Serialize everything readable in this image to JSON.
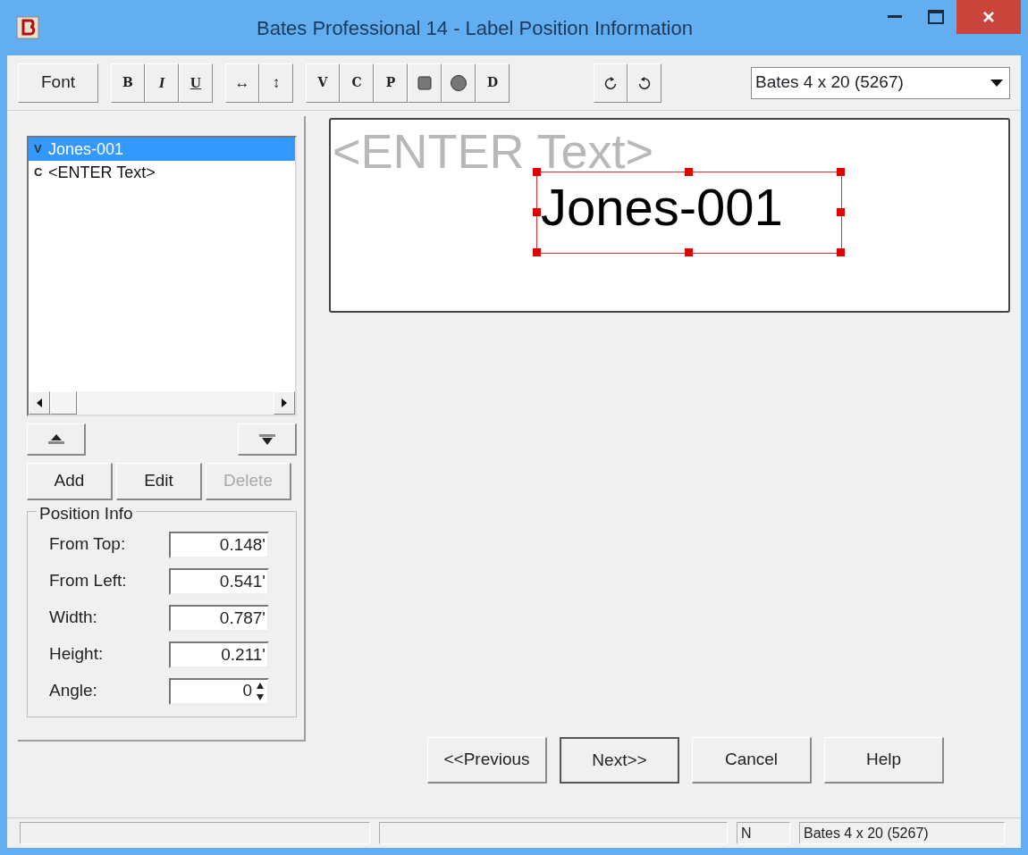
{
  "window": {
    "title": "Bates Professional 14 - Label Position Information"
  },
  "toolbar": {
    "groups": [
      {
        "buttons": [
          {
            "kind": "text",
            "label": "Font"
          }
        ]
      },
      {
        "buttons": [
          {
            "kind": "bold",
            "label": "B"
          },
          {
            "kind": "italic",
            "label": "I"
          },
          {
            "kind": "underline",
            "label": "U"
          }
        ]
      },
      {
        "buttons": [
          {
            "kind": "text",
            "label": "↔"
          },
          {
            "kind": "text",
            "label": "↕"
          }
        ]
      },
      {
        "buttons": [
          {
            "kind": "bold",
            "label": "V"
          },
          {
            "kind": "bold",
            "label": "C"
          },
          {
            "kind": "bold",
            "label": "P"
          },
          {
            "kind": "square"
          },
          {
            "kind": "circle"
          },
          {
            "kind": "bold",
            "label": "D"
          }
        ]
      },
      {
        "buttons": [
          {
            "kind": "rotate-right"
          },
          {
            "kind": "rotate-left"
          }
        ]
      }
    ]
  },
  "template_select": {
    "value": "Bates 4 x 20 (5267)"
  },
  "fields_list": {
    "items": [
      {
        "type": "V",
        "text": "Jones-001",
        "selected": true
      },
      {
        "type": "C",
        "text": "<ENTER Text>",
        "selected": false
      }
    ]
  },
  "actions": [
    {
      "label": "Add",
      "disabled": false
    },
    {
      "label": "Edit",
      "disabled": false
    },
    {
      "label": "Delete",
      "disabled": true
    }
  ],
  "position_info": {
    "title": "Position Info",
    "rows": [
      {
        "kind": "text",
        "label": "From Top:",
        "value": "0.148'"
      },
      {
        "kind": "text",
        "label": "From Left:",
        "value": "0.541'"
      },
      {
        "kind": "text",
        "label": "Width:",
        "value": "0.787'"
      },
      {
        "kind": "text",
        "label": "Height:",
        "value": "0.211'"
      },
      {
        "kind": "spinner",
        "label": "Angle:",
        "value": "0"
      }
    ]
  },
  "preview": {
    "items": [
      {
        "text": "<ENTER Text>",
        "selected": false
      },
      {
        "text": "Jones-001",
        "selected": true
      }
    ]
  },
  "nav_buttons": [
    {
      "label": "<<Previous",
      "default": false
    },
    {
      "label": "Next>>",
      "default": true
    },
    {
      "label": "Cancel",
      "default": false
    },
    {
      "label": "Help",
      "default": false
    }
  ],
  "status_bar": {
    "panels": [
      "N",
      "Bates 4 x 20 (5267)"
    ]
  }
}
